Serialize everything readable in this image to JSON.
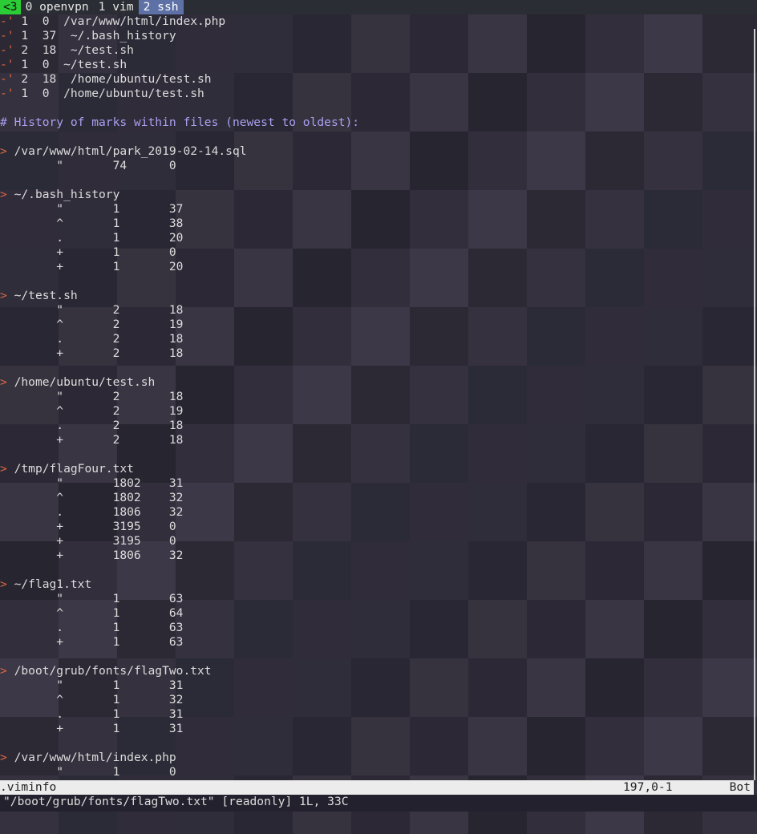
{
  "tabbar": {
    "status": "<3",
    "tabs": [
      {
        "label": "0 openvpn",
        "active": false
      },
      {
        "label": "1 vim",
        "active": false
      },
      {
        "label": "2 ssh",
        "active": true
      }
    ]
  },
  "recent_files": [
    {
      "mark": "-'",
      "line": " 1  0  /var/www/html/index.php"
    },
    {
      "mark": "-'",
      "line": " 1  37  ~/.bash_history"
    },
    {
      "mark": "-'",
      "line": " 2  18  ~/test.sh"
    },
    {
      "mark": "-'",
      "line": " 1  0  ~/test.sh"
    },
    {
      "mark": "-'",
      "line": " 2  18  /home/ubuntu/test.sh"
    },
    {
      "mark": "-'",
      "line": " 1  0  /home/ubuntu/test.sh"
    }
  ],
  "history_heading": "# History of marks within files (newest to oldest):",
  "history_groups": [
    {
      "file": "/var/www/html/park_2019-02-14.sql",
      "marks": [
        {
          "sym": "\"",
          "line": "74",
          "col": "0"
        }
      ]
    },
    {
      "file": "~/.bash_history",
      "marks": [
        {
          "sym": "\"",
          "line": "1",
          "col": "37"
        },
        {
          "sym": "^",
          "line": "1",
          "col": "38"
        },
        {
          "sym": ".",
          "line": "1",
          "col": "20"
        },
        {
          "sym": "+",
          "line": "1",
          "col": "0"
        },
        {
          "sym": "+",
          "line": "1",
          "col": "20"
        }
      ]
    },
    {
      "file": "~/test.sh",
      "marks": [
        {
          "sym": "\"",
          "line": "2",
          "col": "18"
        },
        {
          "sym": "^",
          "line": "2",
          "col": "19"
        },
        {
          "sym": ".",
          "line": "2",
          "col": "18"
        },
        {
          "sym": "+",
          "line": "2",
          "col": "18"
        }
      ]
    },
    {
      "file": "/home/ubuntu/test.sh",
      "marks": [
        {
          "sym": "\"",
          "line": "2",
          "col": "18"
        },
        {
          "sym": "^",
          "line": "2",
          "col": "19"
        },
        {
          "sym": ".",
          "line": "2",
          "col": "18"
        },
        {
          "sym": "+",
          "line": "2",
          "col": "18"
        }
      ]
    },
    {
      "file": "/tmp/flagFour.txt",
      "marks": [
        {
          "sym": "\"",
          "line": "1802",
          "col": "31"
        },
        {
          "sym": "^",
          "line": "1802",
          "col": "32"
        },
        {
          "sym": ".",
          "line": "1806",
          "col": "32"
        },
        {
          "sym": "+",
          "line": "3195",
          "col": "0"
        },
        {
          "sym": "+",
          "line": "3195",
          "col": "0"
        },
        {
          "sym": "+",
          "line": "1806",
          "col": "32"
        }
      ]
    },
    {
      "file": "~/flag1.txt",
      "marks": [
        {
          "sym": "\"",
          "line": "1",
          "col": "63"
        },
        {
          "sym": "^",
          "line": "1",
          "col": "64"
        },
        {
          "sym": ".",
          "line": "1",
          "col": "63"
        },
        {
          "sym": "+",
          "line": "1",
          "col": "63"
        }
      ]
    },
    {
      "file": "/boot/grub/fonts/flagTwo.txt",
      "marks": [
        {
          "sym": "\"",
          "line": "1",
          "col": "31"
        },
        {
          "sym": "^",
          "line": "1",
          "col": "32"
        },
        {
          "sym": ".",
          "line": "1",
          "col": "31"
        },
        {
          "sym": "+",
          "line": "1",
          "col": "31"
        }
      ]
    },
    {
      "file": "/var/www/html/index.php",
      "marks": [
        {
          "sym": "\"",
          "line": "1",
          "col": "0"
        }
      ]
    }
  ],
  "statusline": {
    "filename": ".viminfo",
    "position": "197,0-1",
    "scroll": "Bot"
  },
  "cmdline": "\"/boot/grub/fonts/flagTwo.txt\" [readonly] 1L, 33C",
  "colors": {
    "mark": "#e0663f",
    "comment": "#a9a0f0",
    "active_tab": "#5e71a6",
    "status_tab": "#2bcc36"
  }
}
